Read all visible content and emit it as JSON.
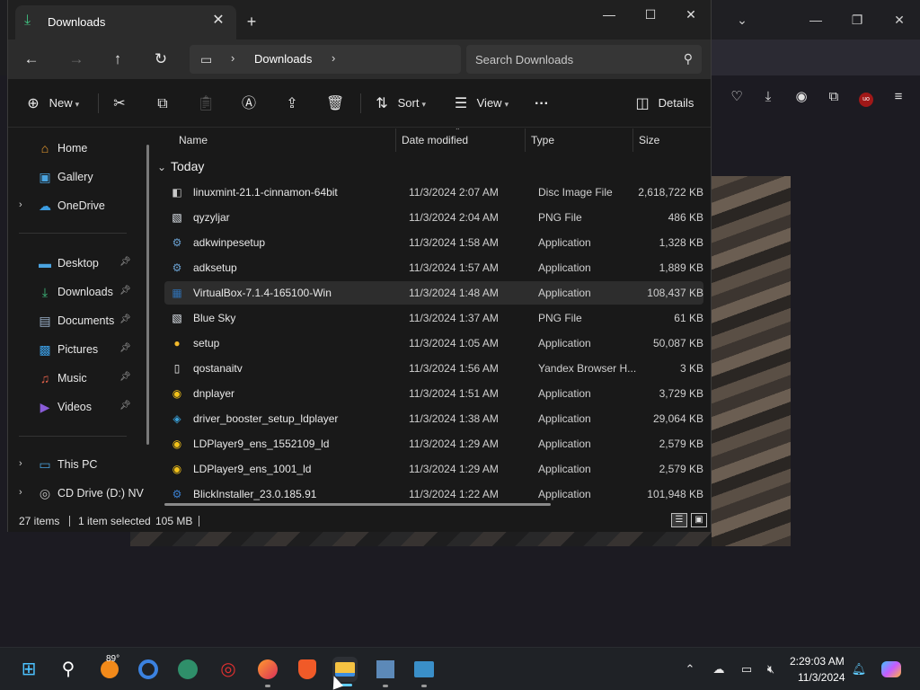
{
  "explorer": {
    "tab_title": "Downloads",
    "tab_icon": "download-icon",
    "address_label": "Downloads",
    "search_placeholder": "Search Downloads",
    "toolbar": {
      "new_label": "New",
      "sort_label": "Sort",
      "view_label": "View",
      "details_label": "Details"
    },
    "columns": {
      "name": "Name",
      "date": "Date modified",
      "type": "Type",
      "size": "Size"
    },
    "group_label": "Today",
    "sidebar": [
      {
        "label": "Home",
        "icon": "home-icon",
        "color": "#f0a030"
      },
      {
        "label": "Gallery",
        "icon": "gallery-icon",
        "color": "#4aa3df"
      },
      {
        "label": "OneDrive",
        "icon": "cloud-icon",
        "color": "#3b9be0"
      },
      {
        "label": "Desktop",
        "icon": "desktop-icon",
        "color": "#4aa3df"
      },
      {
        "label": "Downloads",
        "icon": "download-icon",
        "color": "#3fbf7f"
      },
      {
        "label": "Documents",
        "icon": "documents-icon",
        "color": "#9ab0c8"
      },
      {
        "label": "Pictures",
        "icon": "pictures-icon",
        "color": "#3b9be0"
      },
      {
        "label": "Music",
        "icon": "music-icon",
        "color": "#e0604a"
      },
      {
        "label": "Videos",
        "icon": "videos-icon",
        "color": "#8a5cd8"
      },
      {
        "label": "This PC",
        "icon": "pc-icon",
        "color": "#4aa3df"
      },
      {
        "label": "CD Drive (D:) NV",
        "icon": "cd-drive-icon",
        "color": "#bdbdbd"
      }
    ],
    "files": [
      {
        "name": "linuxmint-21.1-cinnamon-64bit",
        "date": "11/3/2024 2:07 AM",
        "type": "Disc Image File",
        "size": "2,618,722 KB",
        "icon": "disc-image-icon",
        "color": "#c8c8c8"
      },
      {
        "name": "qyzyljar",
        "date": "11/3/2024 2:04 AM",
        "type": "PNG File",
        "size": "486 KB",
        "icon": "image-file-icon",
        "color": "#e8eef5"
      },
      {
        "name": "adkwinpesetup",
        "date": "11/3/2024 1:58 AM",
        "type": "Application",
        "size": "1,328 KB",
        "icon": "installer-icon",
        "color": "#6aa0d0"
      },
      {
        "name": "adksetup",
        "date": "11/3/2024 1:57 AM",
        "type": "Application",
        "size": "1,889 KB",
        "icon": "installer-icon",
        "color": "#6aa0d0"
      },
      {
        "name": "VirtualBox-7.1.4-165100-Win",
        "date": "11/3/2024 1:48 AM",
        "type": "Application",
        "size": "108,437 KB",
        "icon": "virtualbox-icon",
        "color": "#2f6fb0"
      },
      {
        "name": "Blue Sky",
        "date": "11/3/2024 1:37 AM",
        "type": "PNG File",
        "size": "61 KB",
        "icon": "image-file-icon",
        "color": "#e8eef5"
      },
      {
        "name": "setup",
        "date": "11/3/2024 1:05 AM",
        "type": "Application",
        "size": "50,087 KB",
        "icon": "chrome-setup-icon",
        "color": "#f2b92c"
      },
      {
        "name": "qostanaitv",
        "date": "11/3/2024 1:56 AM",
        "type": "Yandex Browser H...",
        "size": "3 KB",
        "icon": "html-file-icon",
        "color": "#f0f0f0"
      },
      {
        "name": "dnplayer",
        "date": "11/3/2024 1:51 AM",
        "type": "Application",
        "size": "3,729 KB",
        "icon": "ldplayer-icon",
        "color": "#f2c21a"
      },
      {
        "name": "driver_booster_setup_ldplayer",
        "date": "11/3/2024 1:38 AM",
        "type": "Application",
        "size": "29,064 KB",
        "icon": "driver-booster-icon",
        "color": "#3aa0d8"
      },
      {
        "name": "LDPlayer9_ens_1552109_ld",
        "date": "11/3/2024 1:29 AM",
        "type": "Application",
        "size": "2,579 KB",
        "icon": "ldplayer-icon",
        "color": "#f2c21a"
      },
      {
        "name": "LDPlayer9_ens_1001_ld",
        "date": "11/3/2024 1:29 AM",
        "type": "Application",
        "size": "2,579 KB",
        "icon": "ldplayer-icon",
        "color": "#f2c21a"
      },
      {
        "name": "BlickInstaller_23.0.185.91",
        "date": "11/3/2024 1:22 AM",
        "type": "Application",
        "size": "101,948 KB",
        "icon": "installer-icon",
        "color": "#3a7fd0"
      }
    ],
    "status": {
      "count": "27 items",
      "selected": "1 item selected",
      "selected_size": "105 MB"
    }
  },
  "taskbar": {
    "weather_temp": "89°",
    "time": "2:29:03 AM",
    "date": "11/3/2024"
  }
}
